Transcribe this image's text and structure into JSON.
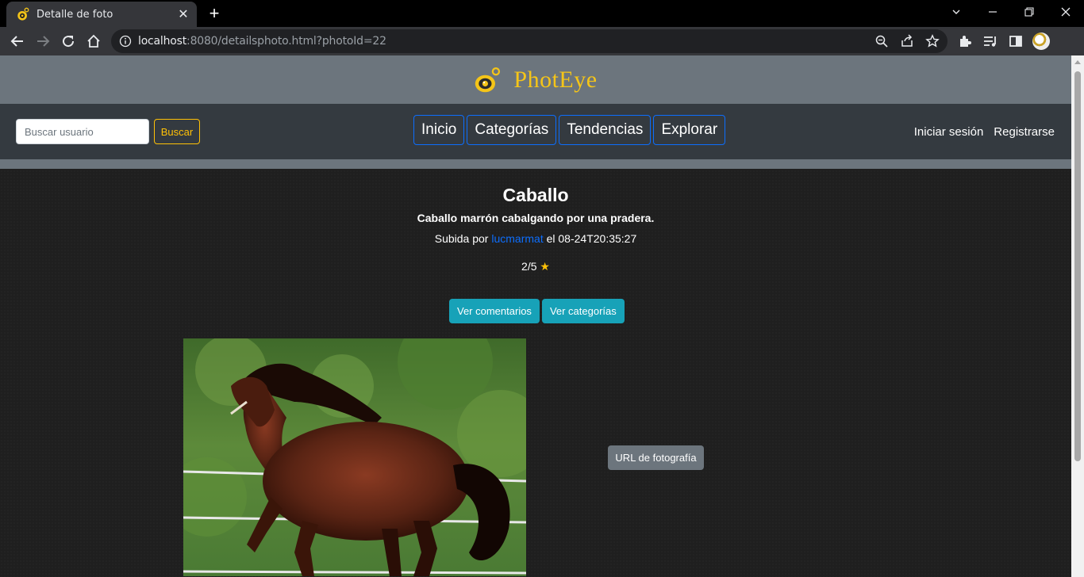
{
  "browser": {
    "tab_title": "Detalle de foto",
    "new_tab": "+",
    "url_host": "localhost",
    "url_rest": ":8080/detailsphoto.html?photoId=22"
  },
  "site": {
    "brand": "PhotEye",
    "search_placeholder": "Buscar usuario",
    "search_button": "Buscar",
    "nav": [
      "Inicio",
      "Categorías",
      "Tendencias",
      "Explorar"
    ],
    "login": "Iniciar sesión",
    "register": "Registrarse"
  },
  "photo": {
    "title": "Caballo",
    "description": "Caballo marrón cabalgando por una pradera.",
    "uploaded_prefix": "Subida por",
    "author": "lucmarmat",
    "uploaded_suffix": "el 08-24T20:35:27",
    "rating": "2/5",
    "star": "★",
    "btn_comments": "Ver comentarios",
    "btn_categories": "Ver categorías",
    "btn_url": "URL de fotografía"
  }
}
